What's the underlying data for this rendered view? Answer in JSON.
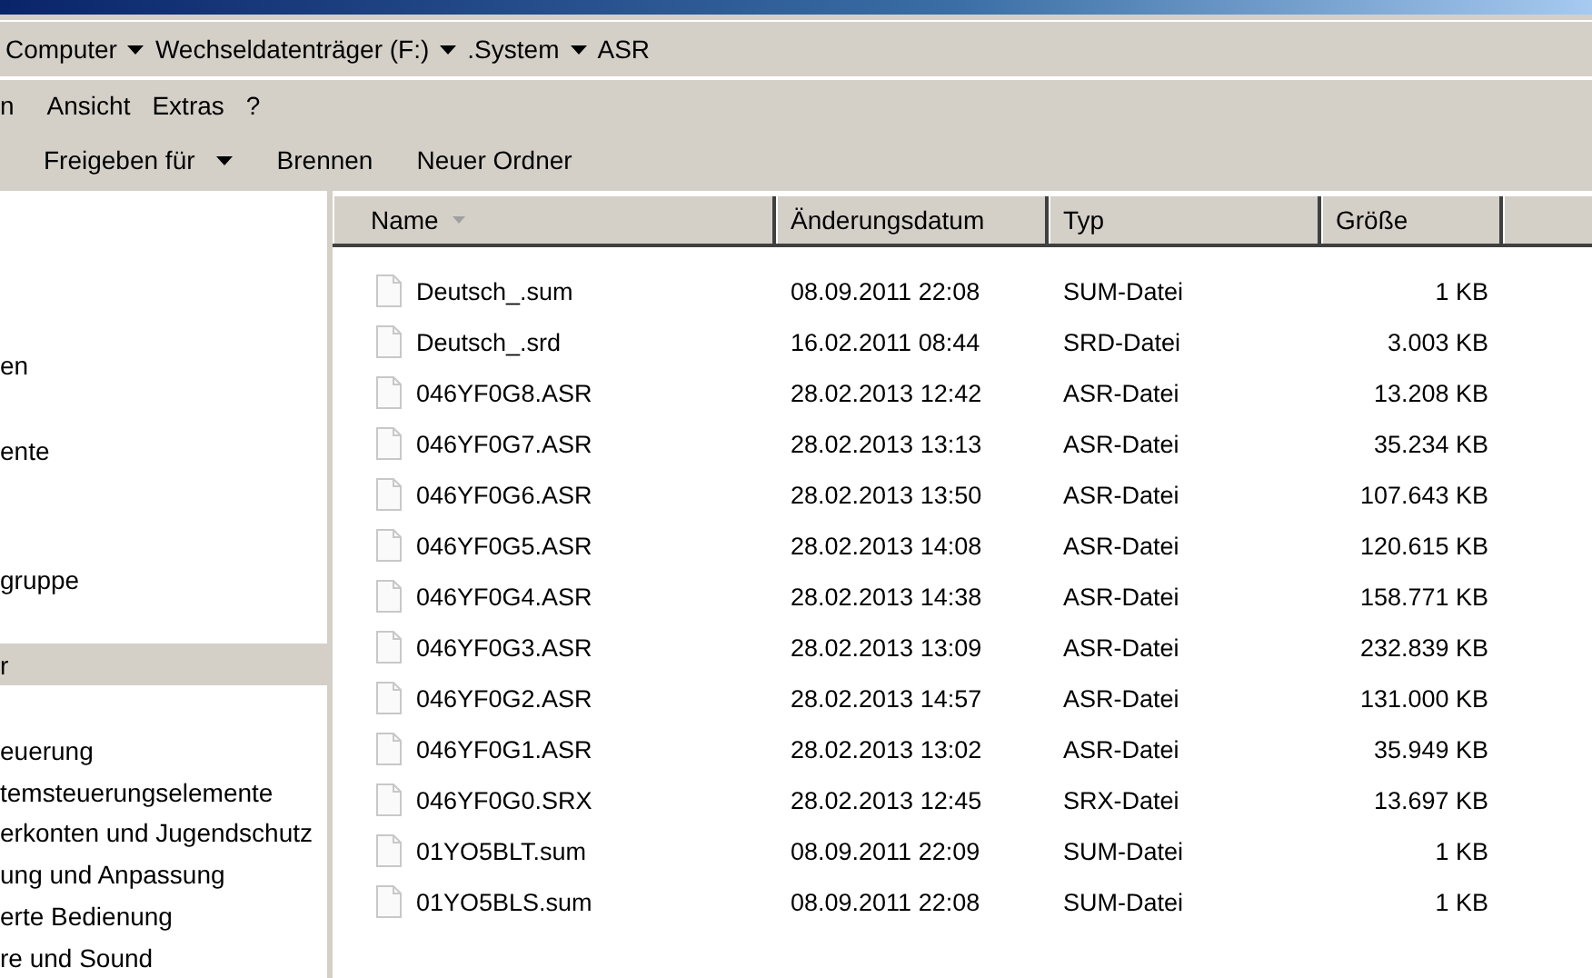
{
  "address_bar": {
    "crumbs": [
      "Computer",
      "Wechseldatenträger (F:)",
      ".System",
      "ASR"
    ]
  },
  "menu_bar": [
    "n",
    "Ansicht",
    "Extras",
    "?"
  ],
  "toolbar": [
    {
      "label": "Freigeben für",
      "dropdown": true
    },
    {
      "label": "Brennen",
      "dropdown": false
    },
    {
      "label": "Neuer Ordner",
      "dropdown": false
    }
  ],
  "sidebar": {
    "items": [
      {
        "label": "en",
        "selected": false
      },
      {
        "label": "ente",
        "selected": false
      },
      {
        "label": "gruppe",
        "selected": false
      },
      {
        "label": "r",
        "selected": true
      },
      {
        "label": "euerung",
        "selected": false
      },
      {
        "label": "temsteuerungselemente",
        "selected": false
      },
      {
        "label": "erkonten und Jugendschutz",
        "selected": false
      },
      {
        "label": "ung und Anpassung",
        "selected": false
      },
      {
        "label": "erte Bedienung",
        "selected": false
      },
      {
        "label": "re und Sound",
        "selected": false
      }
    ]
  },
  "table": {
    "columns": [
      {
        "label": "Name",
        "sorted": true
      },
      {
        "label": "Änderungsdatum",
        "sorted": false
      },
      {
        "label": "Typ",
        "sorted": false
      },
      {
        "label": "Größe",
        "sorted": false
      }
    ],
    "rows": [
      [
        "Deutsch_.sum",
        "08.09.2011 22:08",
        "SUM-Datei",
        "1 KB"
      ],
      [
        "Deutsch_.srd",
        "16.02.2011 08:44",
        "SRD-Datei",
        "3.003 KB"
      ],
      [
        "046YF0G8.ASR",
        "28.02.2013 12:42",
        "ASR-Datei",
        "13.208 KB"
      ],
      [
        "046YF0G7.ASR",
        "28.02.2013 13:13",
        "ASR-Datei",
        "35.234 KB"
      ],
      [
        "046YF0G6.ASR",
        "28.02.2013 13:50",
        "ASR-Datei",
        "107.643 KB"
      ],
      [
        "046YF0G5.ASR",
        "28.02.2013 14:08",
        "ASR-Datei",
        "120.615 KB"
      ],
      [
        "046YF0G4.ASR",
        "28.02.2013 14:38",
        "ASR-Datei",
        "158.771 KB"
      ],
      [
        "046YF0G3.ASR",
        "28.02.2013 13:09",
        "ASR-Datei",
        "232.839 KB"
      ],
      [
        "046YF0G2.ASR",
        "28.02.2013 14:57",
        "ASR-Datei",
        "131.000 KB"
      ],
      [
        "046YF0G1.ASR",
        "28.02.2013 13:02",
        "ASR-Datei",
        "35.949 KB"
      ],
      [
        "046YF0G0.SRX",
        "28.02.2013 12:45",
        "SRX-Datei",
        "13.697 KB"
      ],
      [
        "01YO5BLT.sum",
        "08.09.2011 22:09",
        "SUM-Datei",
        "1 KB"
      ],
      [
        "01YO5BLS.sum",
        "08.09.2011 22:08",
        "SUM-Datei",
        "1 KB"
      ]
    ]
  }
}
